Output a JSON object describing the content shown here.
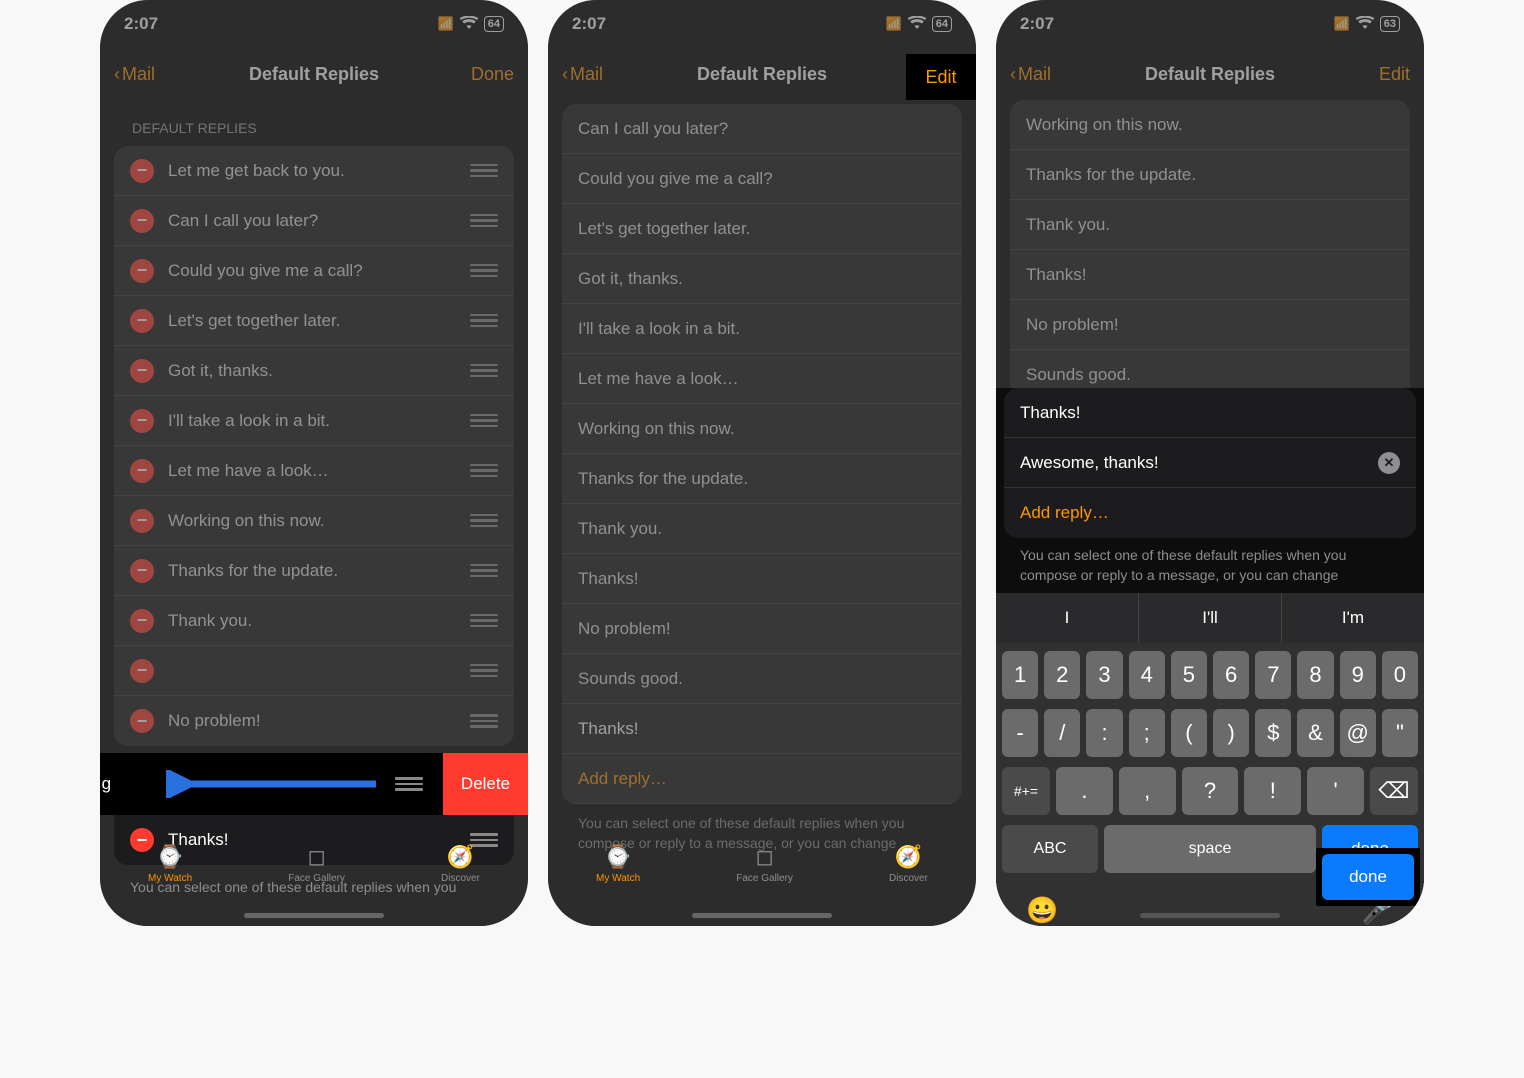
{
  "status": {
    "time": "2:07",
    "battery1": "64",
    "battery3": "63"
  },
  "nav": {
    "back": "Mail",
    "title": "Default Replies",
    "done": "Done",
    "edit": "Edit"
  },
  "section_header": "DEFAULT REPLIES",
  "replies1": [
    "Let me get back to you.",
    "Can I call you later?",
    "Could you give me a call?",
    "Let's get together later.",
    "Got it, thanks.",
    "I'll take a look in a bit.",
    "Let me have a look…",
    "Working on this now.",
    "Thanks for the update.",
    "Thank you.",
    "",
    "No problem!"
  ],
  "swipe": {
    "text": "unds g",
    "delete": "Delete",
    "after": "Thanks!"
  },
  "replies2": [
    "Can I call you later?",
    "Could you give me a call?",
    "Let's get together later.",
    "Got it, thanks.",
    "I'll take a look in a bit.",
    "Let me have a look…",
    "Working on this now.",
    "Thanks for the update.",
    "Thank you.",
    "Thanks!",
    "No problem!",
    "Sounds good.",
    "Thanks!"
  ],
  "add_reply": "Add reply…",
  "footer": "You can select one of these default replies when you compose or reply to a message, or you can change",
  "footer1": "You can select one of these default replies when you",
  "replies3_dim": [
    "Working on this now.",
    "Thanks for the update.",
    "Thank you.",
    "Thanks!",
    "No problem!",
    "Sounds good."
  ],
  "typing": {
    "prev": "Thanks!",
    "current": "Awesome, thanks!",
    "add": "Add reply…"
  },
  "suggestions": [
    "I",
    "I'll",
    "I'm"
  ],
  "keyboard": {
    "row1": [
      "1",
      "2",
      "3",
      "4",
      "5",
      "6",
      "7",
      "8",
      "9",
      "0"
    ],
    "row2": [
      "-",
      "/",
      ":",
      ";",
      "(",
      ")",
      "$",
      "&",
      "@",
      "\""
    ],
    "row3": [
      ".",
      ",",
      "?",
      "!",
      "'"
    ],
    "shift": "#+=",
    "abc": "ABC",
    "space": "space",
    "done": "done"
  },
  "tabs": {
    "watch": "My Watch",
    "gallery": "Face Gallery",
    "discover": "Discover"
  }
}
